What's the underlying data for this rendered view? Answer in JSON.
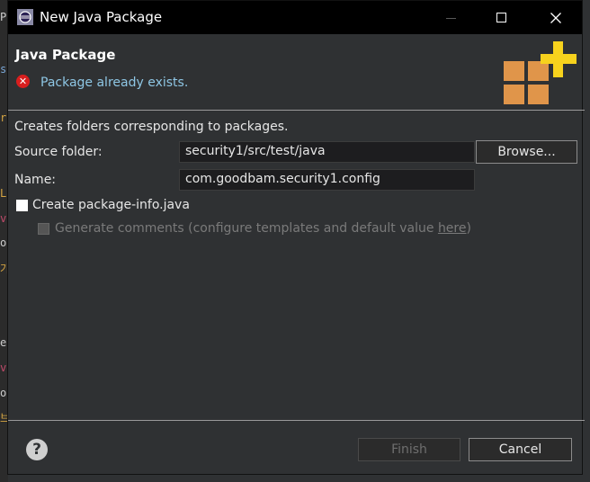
{
  "window": {
    "title": "New Java Package"
  },
  "header": {
    "title": "Java Package",
    "error_message": "Package already exists."
  },
  "form": {
    "description": "Creates folders corresponding to packages.",
    "source_folder_label": "Source folder:",
    "source_folder_value": "security1/src/test/java",
    "browse_label": "Browse...",
    "name_label": "Name:",
    "name_value": "com.goodbam.security1.config",
    "create_package_info_label": "Create package-info.java",
    "generate_comments_label": "Generate comments",
    "configure_text": "(configure templates and default value ",
    "here_link": "here",
    "configure_close": ")"
  },
  "footer": {
    "finish_label": "Finish",
    "cancel_label": "Cancel"
  },
  "background_text": [
    "P",
    "s",
    "r",
    "L",
    "v",
    "o",
    "가",
    "e",
    "v",
    "o",
    "브"
  ]
}
